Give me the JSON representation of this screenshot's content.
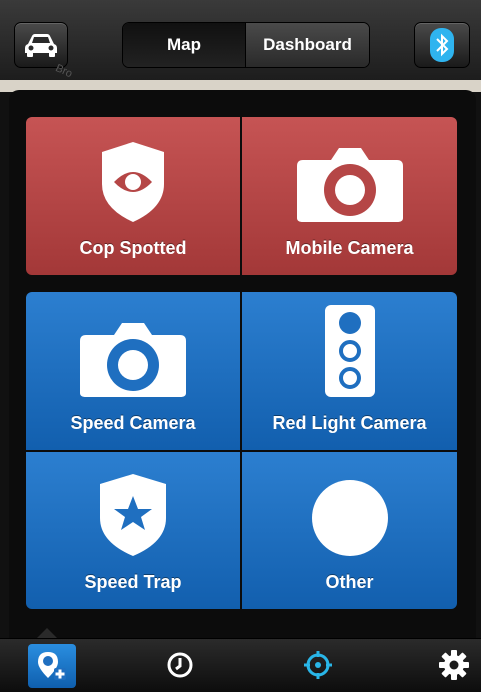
{
  "header": {
    "tabs": [
      {
        "label": "Map",
        "active": true
      },
      {
        "label": "Dashboard",
        "active": false
      }
    ],
    "left_icon": "car-icon",
    "right_icon": "bluetooth-icon"
  },
  "map": {
    "road_label": "Bro"
  },
  "report_menu": {
    "tiles": [
      {
        "label": "Cop Spotted",
        "icon": "police-eye-shield-icon",
        "color": "#b54646"
      },
      {
        "label": "Mobile Camera",
        "icon": "camera-icon",
        "color": "#b54646"
      },
      {
        "label": "Speed Camera",
        "icon": "camera-icon",
        "color": "#1f6fc0"
      },
      {
        "label": "Red Light Camera",
        "icon": "traffic-light-icon",
        "color": "#1f6fc0"
      },
      {
        "label": "Speed Trap",
        "icon": "star-shield-icon",
        "color": "#1f6fc0"
      },
      {
        "label": "Other",
        "icon": "circle-icon",
        "color": "#1f6fc0"
      }
    ]
  },
  "bottom_bar": {
    "items": [
      {
        "icon": "add-report-icon",
        "active": true
      },
      {
        "icon": "history-clock-icon",
        "active": false
      },
      {
        "icon": "locate-crosshair-icon",
        "active": false,
        "color": "#29b6e8"
      },
      {
        "icon": "gear-icon",
        "active": false
      }
    ]
  }
}
